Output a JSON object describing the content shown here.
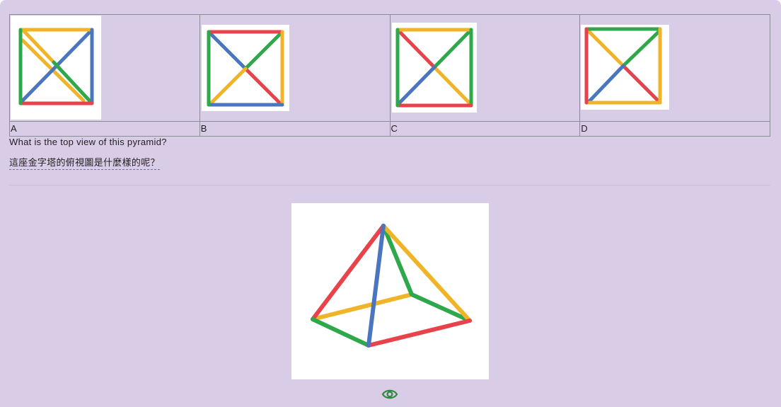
{
  "options": [
    {
      "label": "A",
      "description": "square with crossed diagonals option A"
    },
    {
      "label": "B",
      "description": "square with crossed diagonals option B"
    },
    {
      "label": "C",
      "description": "square with crossed diagonals option C"
    },
    {
      "label": "D",
      "description": "square with crossed diagonals option D"
    }
  ],
  "question": {
    "english": "What is the top view of this pyramid?",
    "chinese": "這座金字塔的俯視圖是什麼樣的呢？"
  },
  "icons": {
    "reveal": "eye-icon"
  },
  "colors": {
    "background": "#d8cce6",
    "red": "#e8424b",
    "yellow": "#f0b429",
    "green": "#2ea84a",
    "blue": "#4a76c0",
    "eye": "#2e8b3e"
  }
}
